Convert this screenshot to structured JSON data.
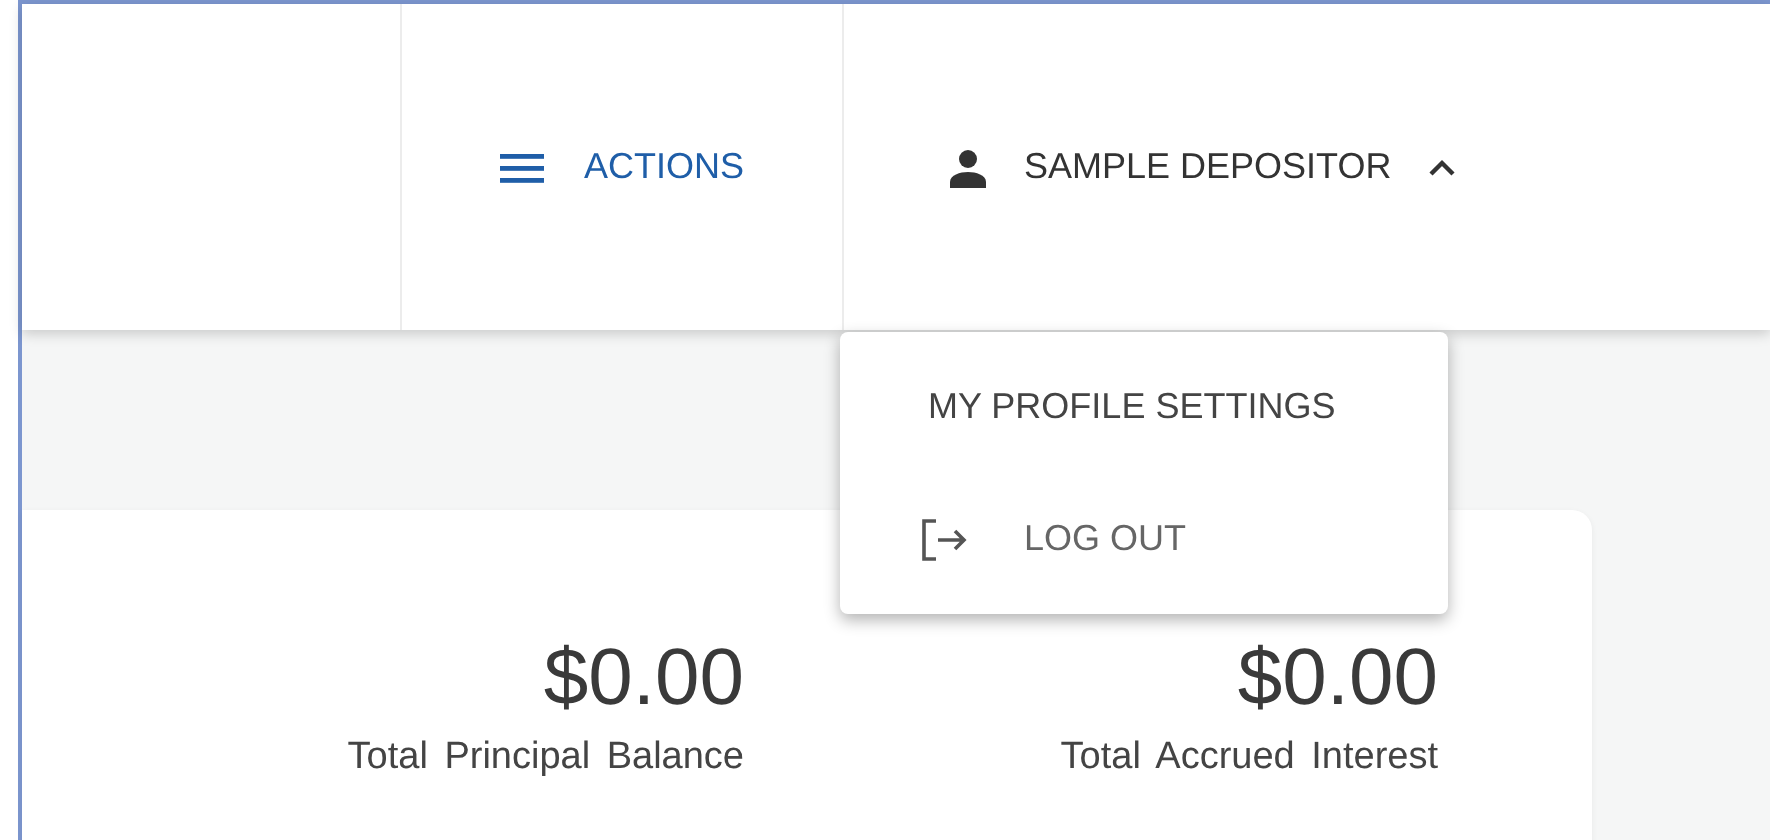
{
  "header": {
    "actions_button": {
      "label": "ACTIONS"
    },
    "user_button": {
      "label": "SAMPLE DEPOSITOR",
      "expanded": true
    }
  },
  "user_menu": [
    {
      "label": "MY PROFILE SETTINGS",
      "kind": "plain"
    },
    {
      "label": "LOG OUT",
      "kind": "logout"
    }
  ],
  "summary": [
    {
      "amount": "$0.00",
      "label": "Total Principal Balance"
    },
    {
      "amount": "$0.00",
      "label": "Total Accrued Interest"
    }
  ]
}
